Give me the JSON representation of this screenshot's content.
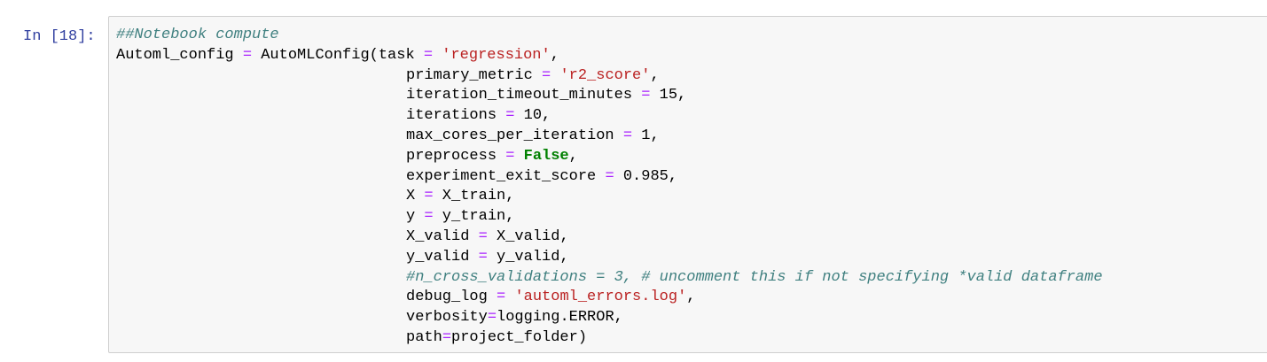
{
  "cell": {
    "prompt": "In [18]:",
    "lines": [
      {
        "tokens": [
          {
            "t": "comment",
            "v": "##Notebook compute"
          }
        ]
      },
      {
        "tokens": [
          {
            "t": "txt",
            "v": "Automl_config "
          },
          {
            "t": "op",
            "v": "="
          },
          {
            "t": "txt",
            "v": " AutoMLConfig(task "
          },
          {
            "t": "op",
            "v": "="
          },
          {
            "t": "txt",
            "v": " "
          },
          {
            "t": "str",
            "v": "'regression'"
          },
          {
            "t": "txt",
            "v": ","
          }
        ]
      },
      {
        "indent": true,
        "tokens": [
          {
            "t": "txt",
            "v": "primary_metric "
          },
          {
            "t": "op",
            "v": "="
          },
          {
            "t": "txt",
            "v": " "
          },
          {
            "t": "str",
            "v": "'r2_score'"
          },
          {
            "t": "txt",
            "v": ","
          }
        ]
      },
      {
        "indent": true,
        "tokens": [
          {
            "t": "txt",
            "v": "iteration_timeout_minutes "
          },
          {
            "t": "op",
            "v": "="
          },
          {
            "t": "txt",
            "v": " 15,"
          }
        ]
      },
      {
        "indent": true,
        "tokens": [
          {
            "t": "txt",
            "v": "iterations "
          },
          {
            "t": "op",
            "v": "="
          },
          {
            "t": "txt",
            "v": " 10,"
          }
        ]
      },
      {
        "indent": true,
        "tokens": [
          {
            "t": "txt",
            "v": "max_cores_per_iteration "
          },
          {
            "t": "op",
            "v": "="
          },
          {
            "t": "txt",
            "v": " 1,"
          }
        ]
      },
      {
        "indent": true,
        "tokens": [
          {
            "t": "txt",
            "v": "preprocess "
          },
          {
            "t": "op",
            "v": "="
          },
          {
            "t": "txt",
            "v": " "
          },
          {
            "t": "kw",
            "v": "False"
          },
          {
            "t": "txt",
            "v": ","
          }
        ]
      },
      {
        "indent": true,
        "tokens": [
          {
            "t": "txt",
            "v": "experiment_exit_score "
          },
          {
            "t": "op",
            "v": "="
          },
          {
            "t": "txt",
            "v": " 0.985,"
          }
        ]
      },
      {
        "indent": true,
        "tokens": [
          {
            "t": "txt",
            "v": "X "
          },
          {
            "t": "op",
            "v": "="
          },
          {
            "t": "txt",
            "v": " X_train,"
          }
        ]
      },
      {
        "indent": true,
        "tokens": [
          {
            "t": "txt",
            "v": "y "
          },
          {
            "t": "op",
            "v": "="
          },
          {
            "t": "txt",
            "v": " y_train,"
          }
        ]
      },
      {
        "indent": true,
        "tokens": [
          {
            "t": "txt",
            "v": "X_valid "
          },
          {
            "t": "op",
            "v": "="
          },
          {
            "t": "txt",
            "v": " X_valid,"
          }
        ]
      },
      {
        "indent": true,
        "tokens": [
          {
            "t": "txt",
            "v": "y_valid "
          },
          {
            "t": "op",
            "v": "="
          },
          {
            "t": "txt",
            "v": " y_valid,"
          }
        ]
      },
      {
        "indent": true,
        "tokens": [
          {
            "t": "comment",
            "v": "#n_cross_validations = 3, # uncomment this if not specifying *valid dataframe"
          }
        ]
      },
      {
        "indent": true,
        "tokens": [
          {
            "t": "txt",
            "v": "debug_log "
          },
          {
            "t": "op",
            "v": "="
          },
          {
            "t": "txt",
            "v": " "
          },
          {
            "t": "str",
            "v": "'automl_errors.log'"
          },
          {
            "t": "txt",
            "v": ","
          }
        ]
      },
      {
        "indent": true,
        "tokens": [
          {
            "t": "txt",
            "v": "verbosity"
          },
          {
            "t": "op",
            "v": "="
          },
          {
            "t": "txt",
            "v": "logging.ERROR,"
          }
        ]
      },
      {
        "indent": true,
        "tokens": [
          {
            "t": "txt",
            "v": "path"
          },
          {
            "t": "op",
            "v": "="
          },
          {
            "t": "txt",
            "v": "project_folder)"
          }
        ]
      }
    ]
  },
  "colors": {
    "prompt": "#303f9f",
    "cell_background": "#f7f7f7",
    "cell_border": "#cfcfcf",
    "comment": "#408080",
    "string": "#ba2121",
    "operator": "#aa22ff",
    "keyword": "#008000"
  }
}
